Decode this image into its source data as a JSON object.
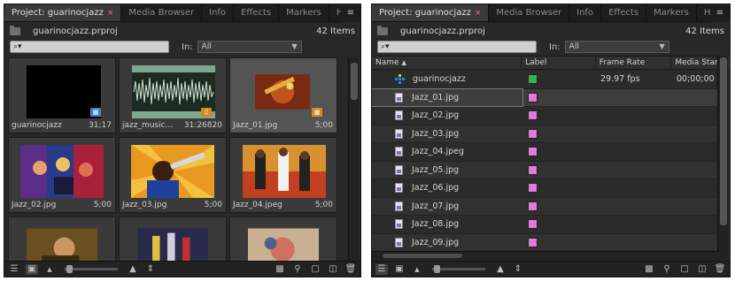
{
  "left": {
    "tabs": [
      {
        "label": "Project: guarinocjazz",
        "close": "×",
        "active": true
      },
      {
        "label": "Media Browser"
      },
      {
        "label": "Info"
      },
      {
        "label": "Effects"
      },
      {
        "label": "Markers"
      },
      {
        "label": "Hi"
      }
    ],
    "menu_icon": "panel-menu-icon",
    "project_file": "guarinocjazz.prproj",
    "item_count": "42 Items",
    "search_placeholder": "",
    "search_icon": "⌕▾",
    "in_label": "In:",
    "in_value": "All",
    "tiles": [
      {
        "name": "guarinocjazz",
        "duration": "31;17",
        "thumb": "black",
        "badge": "sequence-icon",
        "badge_color": "#3b83c9"
      },
      {
        "name": "jazz_music...",
        "duration": "31:26820",
        "thumb": "waveform",
        "badge": "audio-icon",
        "badge_color": "#d88a1a"
      },
      {
        "name": "Jazz_01.jpg",
        "duration": "5;00",
        "thumb": "jazz01",
        "badge": "image-icon",
        "badge_color": "#d88a1a",
        "selected": true
      },
      {
        "name": "Jazz_02.jpg",
        "duration": "5;00",
        "thumb": "jazz02"
      },
      {
        "name": "Jazz_03.jpg",
        "duration": "5;00",
        "thumb": "jazz03"
      },
      {
        "name": "Jazz_04.jpeg",
        "duration": "5;00",
        "thumb": "jazz04"
      },
      {
        "name": "",
        "duration": "",
        "thumb": "jazz05"
      },
      {
        "name": "",
        "duration": "",
        "thumb": "jazz06"
      },
      {
        "name": "",
        "duration": "",
        "thumb": "jazz07"
      }
    ]
  },
  "right": {
    "tabs": [
      {
        "label": "Project: guarinocjazz",
        "close": "×",
        "active": true
      },
      {
        "label": "Media Browser"
      },
      {
        "label": "Info"
      },
      {
        "label": "Effects"
      },
      {
        "label": "Markers"
      },
      {
        "label": "Hi"
      }
    ],
    "project_file": "guarinocjazz.prproj",
    "item_count": "42 Items",
    "in_label": "In:",
    "in_value": "All",
    "columns": {
      "name": "Name",
      "sort_arrow": "▲",
      "label": "Label",
      "frame_rate": "Frame Rate",
      "media_start": "Media Start"
    },
    "rows": [
      {
        "name": "guarinocjazz",
        "type": "sequence",
        "label_color": "#35b04a",
        "frame_rate": "29.97 fps",
        "media_start": "00;00;00"
      },
      {
        "name": "Jazz_01.jpg",
        "type": "image",
        "label_color": "#e27ad9",
        "frame_rate": "",
        "media_start": "",
        "selected": true
      },
      {
        "name": "Jazz_02.jpg",
        "type": "image",
        "label_color": "#e27ad9",
        "frame_rate": "",
        "media_start": ""
      },
      {
        "name": "Jazz_03.jpg",
        "type": "image",
        "label_color": "#e27ad9",
        "frame_rate": "",
        "media_start": ""
      },
      {
        "name": "Jazz_04.jpeg",
        "type": "image",
        "label_color": "#e27ad9",
        "frame_rate": "",
        "media_start": ""
      },
      {
        "name": "Jazz_05.jpg",
        "type": "image",
        "label_color": "#e27ad9",
        "frame_rate": "",
        "media_start": ""
      },
      {
        "name": "Jazz_06.jpg",
        "type": "image",
        "label_color": "#e27ad9",
        "frame_rate": "",
        "media_start": ""
      },
      {
        "name": "Jazz_07.jpg",
        "type": "image",
        "label_color": "#e27ad9",
        "frame_rate": "",
        "media_start": ""
      },
      {
        "name": "Jazz_08.jpg",
        "type": "image",
        "label_color": "#e27ad9",
        "frame_rate": "",
        "media_start": ""
      },
      {
        "name": "Jazz_09.jpg",
        "type": "image",
        "label_color": "#e27ad9",
        "frame_rate": "",
        "media_start": ""
      }
    ]
  },
  "bottombar_icons": [
    "list-view-icon",
    "icon-view-icon",
    "zoom-slider",
    "automate-to-sequence-icon",
    "find-icon",
    "new-bin-icon",
    "new-item-icon",
    "trash-icon"
  ]
}
